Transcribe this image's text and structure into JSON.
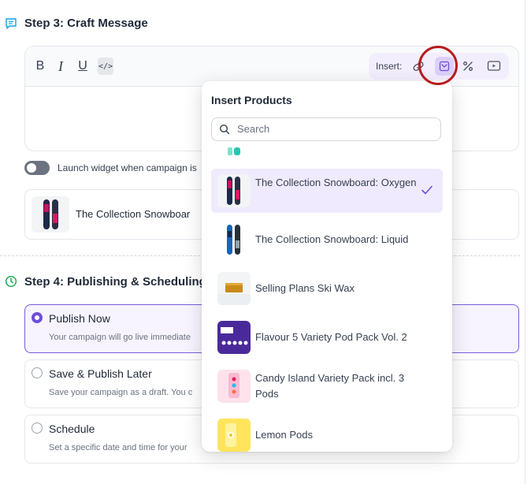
{
  "step3": {
    "title": "Step 3: Craft Message"
  },
  "editor": {
    "bold": "B",
    "italic": "I",
    "underline": "U",
    "code": "</>",
    "insert_label": "Insert:"
  },
  "widget_toggle": {
    "label": "Launch widget when campaign is"
  },
  "selected_product": {
    "name": "The Collection Snowboar"
  },
  "step4": {
    "title": "Step 4: Publishing & Scheduling"
  },
  "publish_options": [
    {
      "title": "Publish Now",
      "desc": "Your campaign will go live immediate",
      "selected": true
    },
    {
      "title": "Save & Publish Later",
      "desc": "Save your campaign as a draft. You c",
      "selected": false
    },
    {
      "title": "Schedule",
      "desc": "Set a specific date and time for your",
      "selected": false
    }
  ],
  "insert_products": {
    "title": "Insert Products",
    "search_placeholder": "Search",
    "items": [
      {
        "name": "The Collection Snowboard: Oxygen",
        "selected": true
      },
      {
        "name": "The Collection Snowboard: Liquid",
        "selected": false
      },
      {
        "name": "Selling Plans Ski Wax",
        "selected": false
      },
      {
        "name": "Flavour 5 Variety Pod Pack Vol. 2",
        "selected": false
      },
      {
        "name": "Candy Island Variety Pack incl. 3 Pods",
        "selected": false
      },
      {
        "name": "Lemon Pods",
        "selected": false
      }
    ]
  },
  "colors": {
    "accent": "#6d4ed8",
    "selected_bg": "#efeafd",
    "highlight_ring": "#b71c1c",
    "step3_icon": "#0ea5e9",
    "step4_icon": "#16a34a"
  }
}
